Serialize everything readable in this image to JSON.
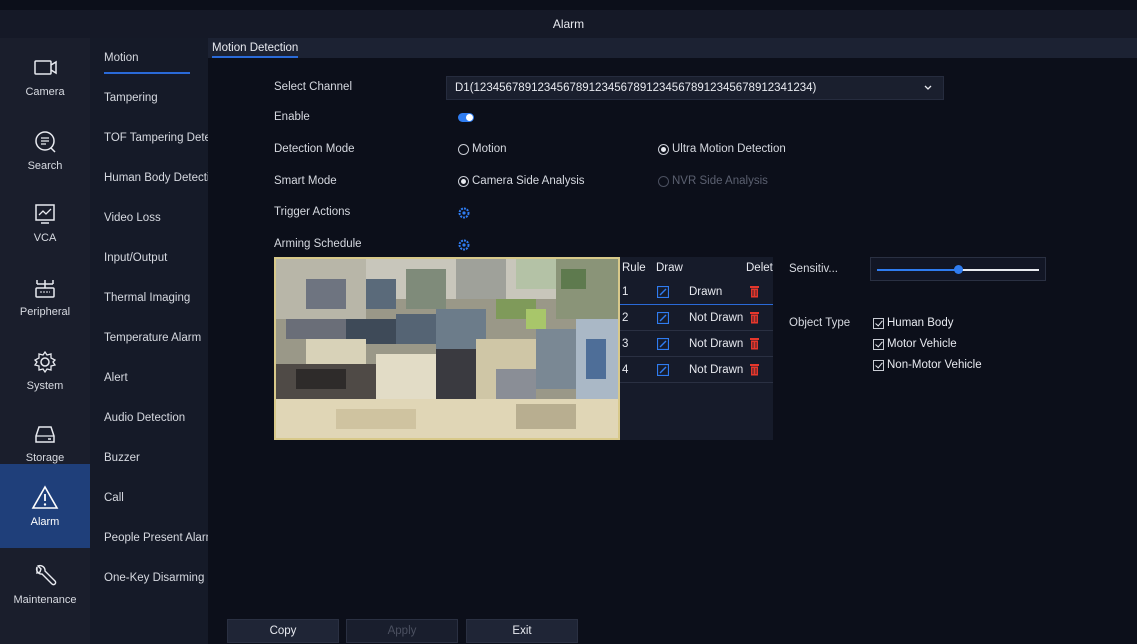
{
  "window": {
    "title": "Alarm"
  },
  "rail": [
    {
      "label": "Camera",
      "icon": "camera-icon"
    },
    {
      "label": "Search",
      "icon": "search-icon"
    },
    {
      "label": "VCA",
      "icon": "vca-icon"
    },
    {
      "label": "Peripheral",
      "icon": "peripheral-icon"
    },
    {
      "label": "System",
      "icon": "gear-icon"
    },
    {
      "label": "Storage",
      "icon": "storage-icon"
    },
    {
      "label": "Alarm",
      "icon": "alarm-icon",
      "active": true
    },
    {
      "label": "Maintenance",
      "icon": "wrench-icon"
    }
  ],
  "submenu": [
    {
      "label": "Motion",
      "active": true
    },
    {
      "label": "Tampering"
    },
    {
      "label": "TOF Tampering Dete..."
    },
    {
      "label": "Human Body Detecti..."
    },
    {
      "label": "Video Loss"
    },
    {
      "label": "Input/Output"
    },
    {
      "label": "Thermal Imaging"
    },
    {
      "label": "Temperature Alarm"
    },
    {
      "label": "Alert"
    },
    {
      "label": "Audio Detection"
    },
    {
      "label": "Buzzer"
    },
    {
      "label": "Call"
    },
    {
      "label": "People Present Alarm"
    },
    {
      "label": "One-Key Disarming"
    }
  ],
  "tab": {
    "label": "Motion Detection"
  },
  "form": {
    "select_channel_label": "Select Channel",
    "select_channel_value": "D1(12345678912345678912345678912345678912345678912341234)",
    "enable_label": "Enable",
    "enable_on": true,
    "detection_mode_label": "Detection Mode",
    "detection_mode_options": [
      "Motion",
      "Ultra Motion Detection"
    ],
    "detection_mode_selected": "Ultra Motion Detection",
    "smart_mode_label": "Smart Mode",
    "smart_mode_options": [
      "Camera Side Analysis",
      "NVR Side Analysis"
    ],
    "smart_mode_selected": "Camera Side Analysis",
    "trigger_actions_label": "Trigger Actions",
    "arming_schedule_label": "Arming Schedule"
  },
  "rules_table": {
    "headers": [
      "Rule",
      "Draw",
      "Delete"
    ],
    "rows": [
      {
        "rule": "1",
        "status": "Drawn"
      },
      {
        "rule": "2",
        "status": "Not Drawn"
      },
      {
        "rule": "3",
        "status": "Not Drawn"
      },
      {
        "rule": "4",
        "status": "Not Drawn"
      }
    ]
  },
  "sensitivity": {
    "label": "Sensitiv...",
    "value_fraction": 0.5
  },
  "object_type": {
    "label": "Object Type",
    "options": [
      "Human Body",
      "Motor Vehicle",
      "Non-Motor Vehicle"
    ],
    "checked": [
      true,
      true,
      true
    ]
  },
  "buttons": {
    "copy": "Copy",
    "apply": "Apply",
    "exit": "Exit"
  },
  "colors": {
    "accent": "#2f7cf0",
    "active_rail": "#1f3f7a",
    "delete": "#e5372c"
  }
}
